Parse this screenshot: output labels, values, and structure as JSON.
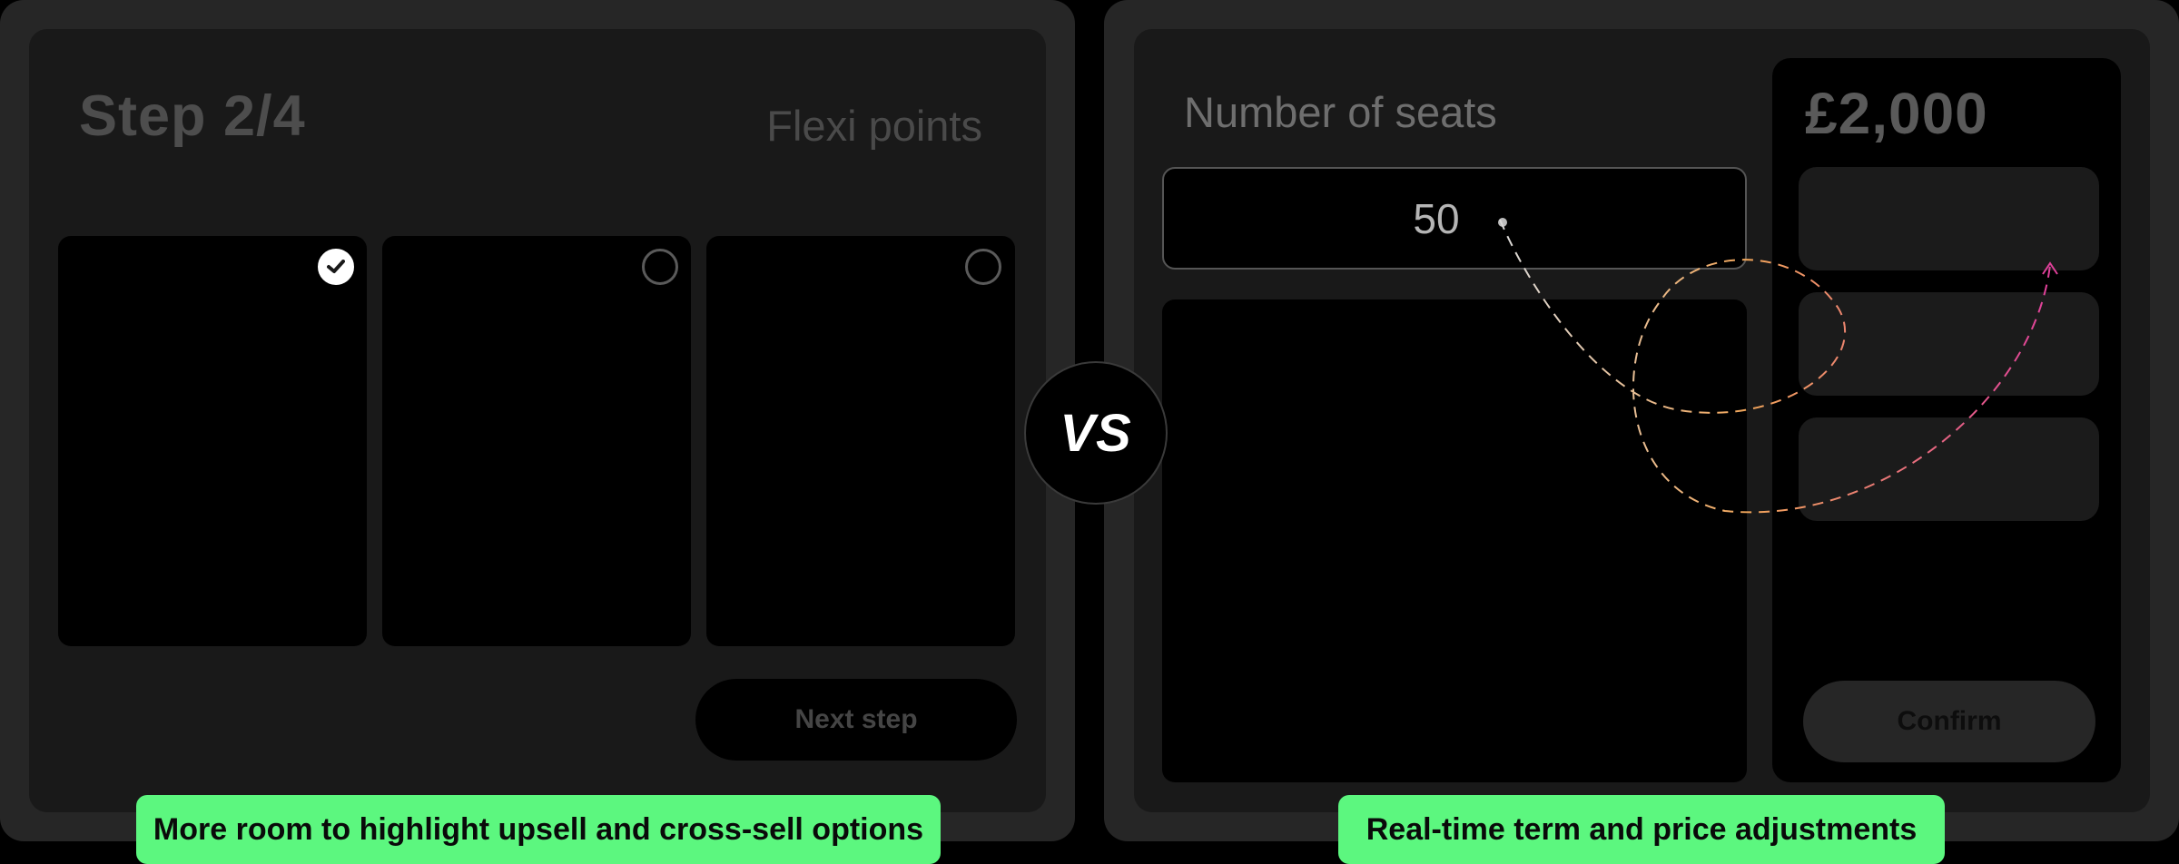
{
  "left_panel": {
    "step_title": "Step 2/4",
    "category_label": "Flexi points",
    "cards": [
      {
        "selected": true
      },
      {
        "selected": false
      },
      {
        "selected": false
      }
    ],
    "next_button_label": "Next step",
    "caption": "More room to highlight upsell and cross-sell options"
  },
  "vs_label": "VS",
  "right_panel": {
    "seats_label": "Number of seats",
    "seats_value": "50",
    "price": "£2,000",
    "confirm_button_label": "Confirm",
    "caption": "Real-time term and price adjustments"
  },
  "colors": {
    "caption_bg": "#5cf77f",
    "guide_pink": "#e0409a",
    "guide_orange": "#f2a65a",
    "panel_bg": "#191919"
  }
}
